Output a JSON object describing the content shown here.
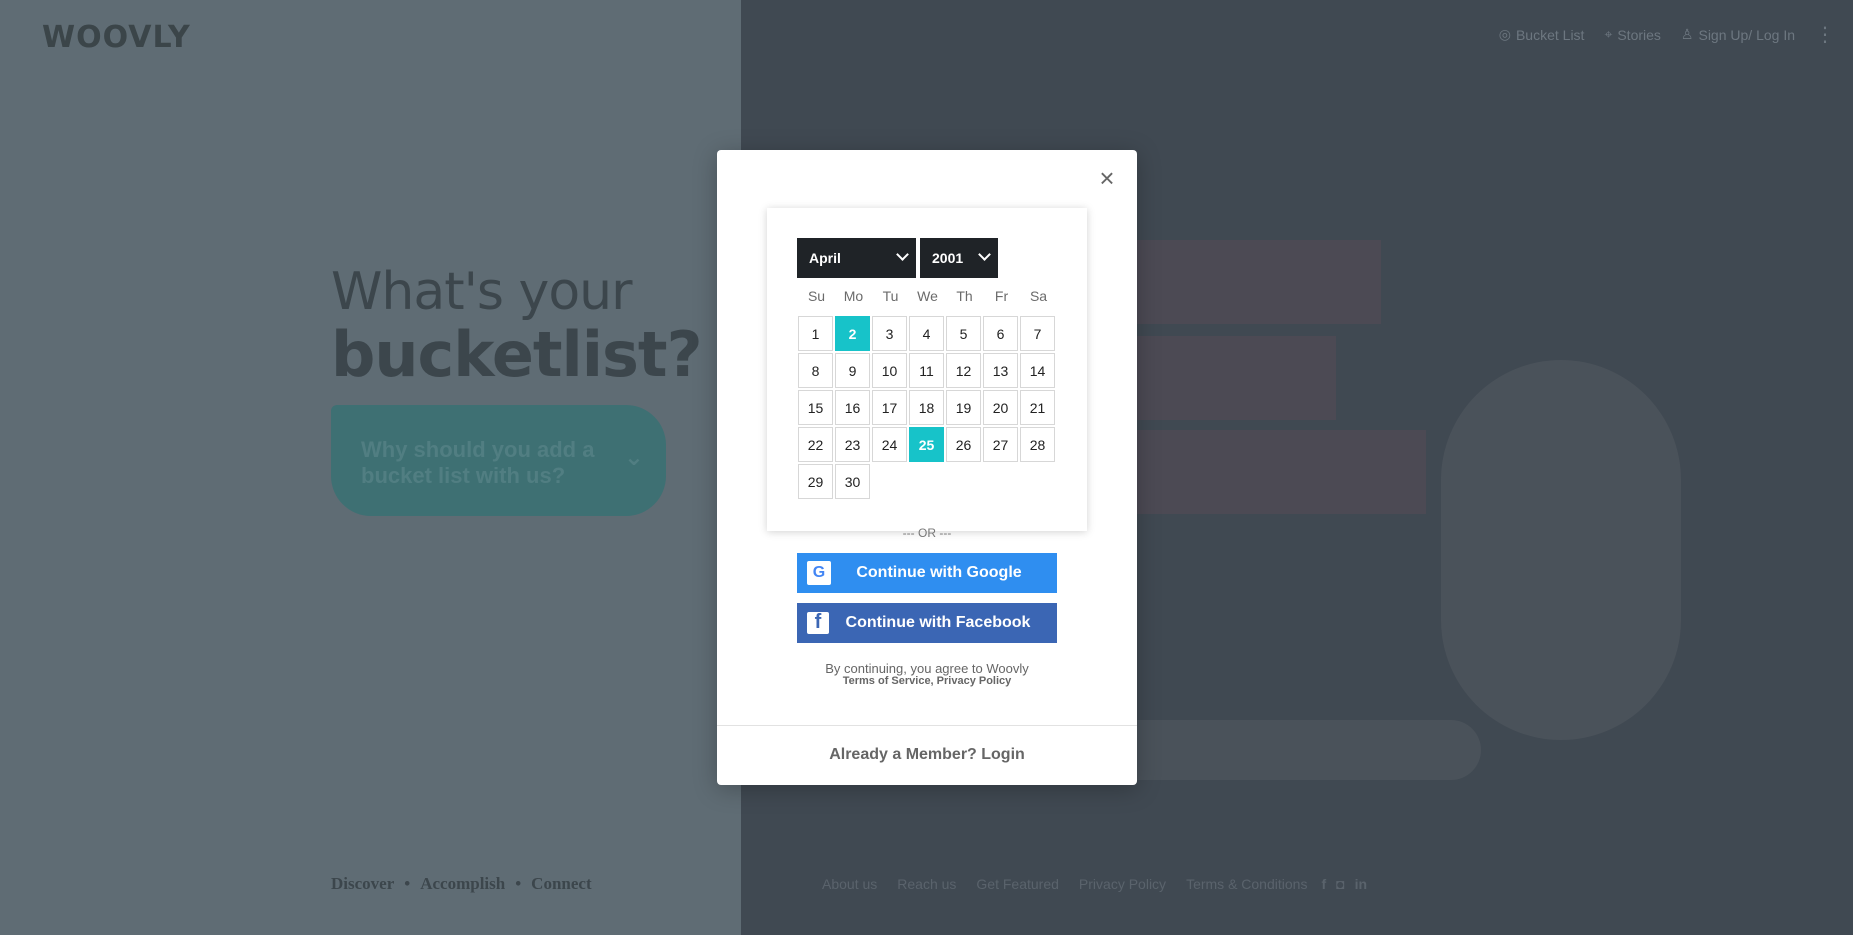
{
  "header": {
    "logo": "WOOVLY",
    "nav": [
      {
        "label": "Bucket List",
        "icon": "compass-icon"
      },
      {
        "label": "Stories",
        "icon": "pin-icon"
      },
      {
        "label": "Sign Up/ Log In",
        "icon": "user-icon"
      }
    ]
  },
  "hero": {
    "line1": "What's your",
    "line2": "bucketlist?",
    "why_button": "Why should you add a bucket list with us?"
  },
  "tagline": {
    "items": [
      "Discover",
      "Accomplish",
      "Connect"
    ],
    "separator": "•"
  },
  "footer": {
    "links": [
      "About us",
      "Reach us",
      "Get Featured",
      "Privacy Policy",
      "Terms & Conditions"
    ],
    "social": [
      "facebook-icon",
      "instagram-icon",
      "linkedin-icon"
    ]
  },
  "modal": {
    "datepicker": {
      "month": "April",
      "year": "2001",
      "weekdays": [
        "Su",
        "Mo",
        "Tu",
        "We",
        "Th",
        "Fr",
        "Sa"
      ],
      "days": [
        "1",
        "2",
        "3",
        "4",
        "5",
        "6",
        "7",
        "8",
        "9",
        "10",
        "11",
        "12",
        "13",
        "14",
        "15",
        "16",
        "17",
        "18",
        "19",
        "20",
        "21",
        "22",
        "23",
        "24",
        "25",
        "26",
        "27",
        "28",
        "29",
        "30"
      ],
      "highlighted_days": [
        "2",
        "25"
      ]
    },
    "or_text": "--- OR ---",
    "google_button": "Continue with Google",
    "facebook_button": "Continue with Facebook",
    "terms_text": "By continuing, you agree to Woovly",
    "terms_links": "Terms of Service, Privacy Policy",
    "login_link": "Already a Member? Login"
  },
  "colors": {
    "accent": "#17c3c9",
    "google_blue": "#2f8ef0",
    "facebook_blue": "#3b66b4",
    "select_bg": "#1f2327"
  }
}
